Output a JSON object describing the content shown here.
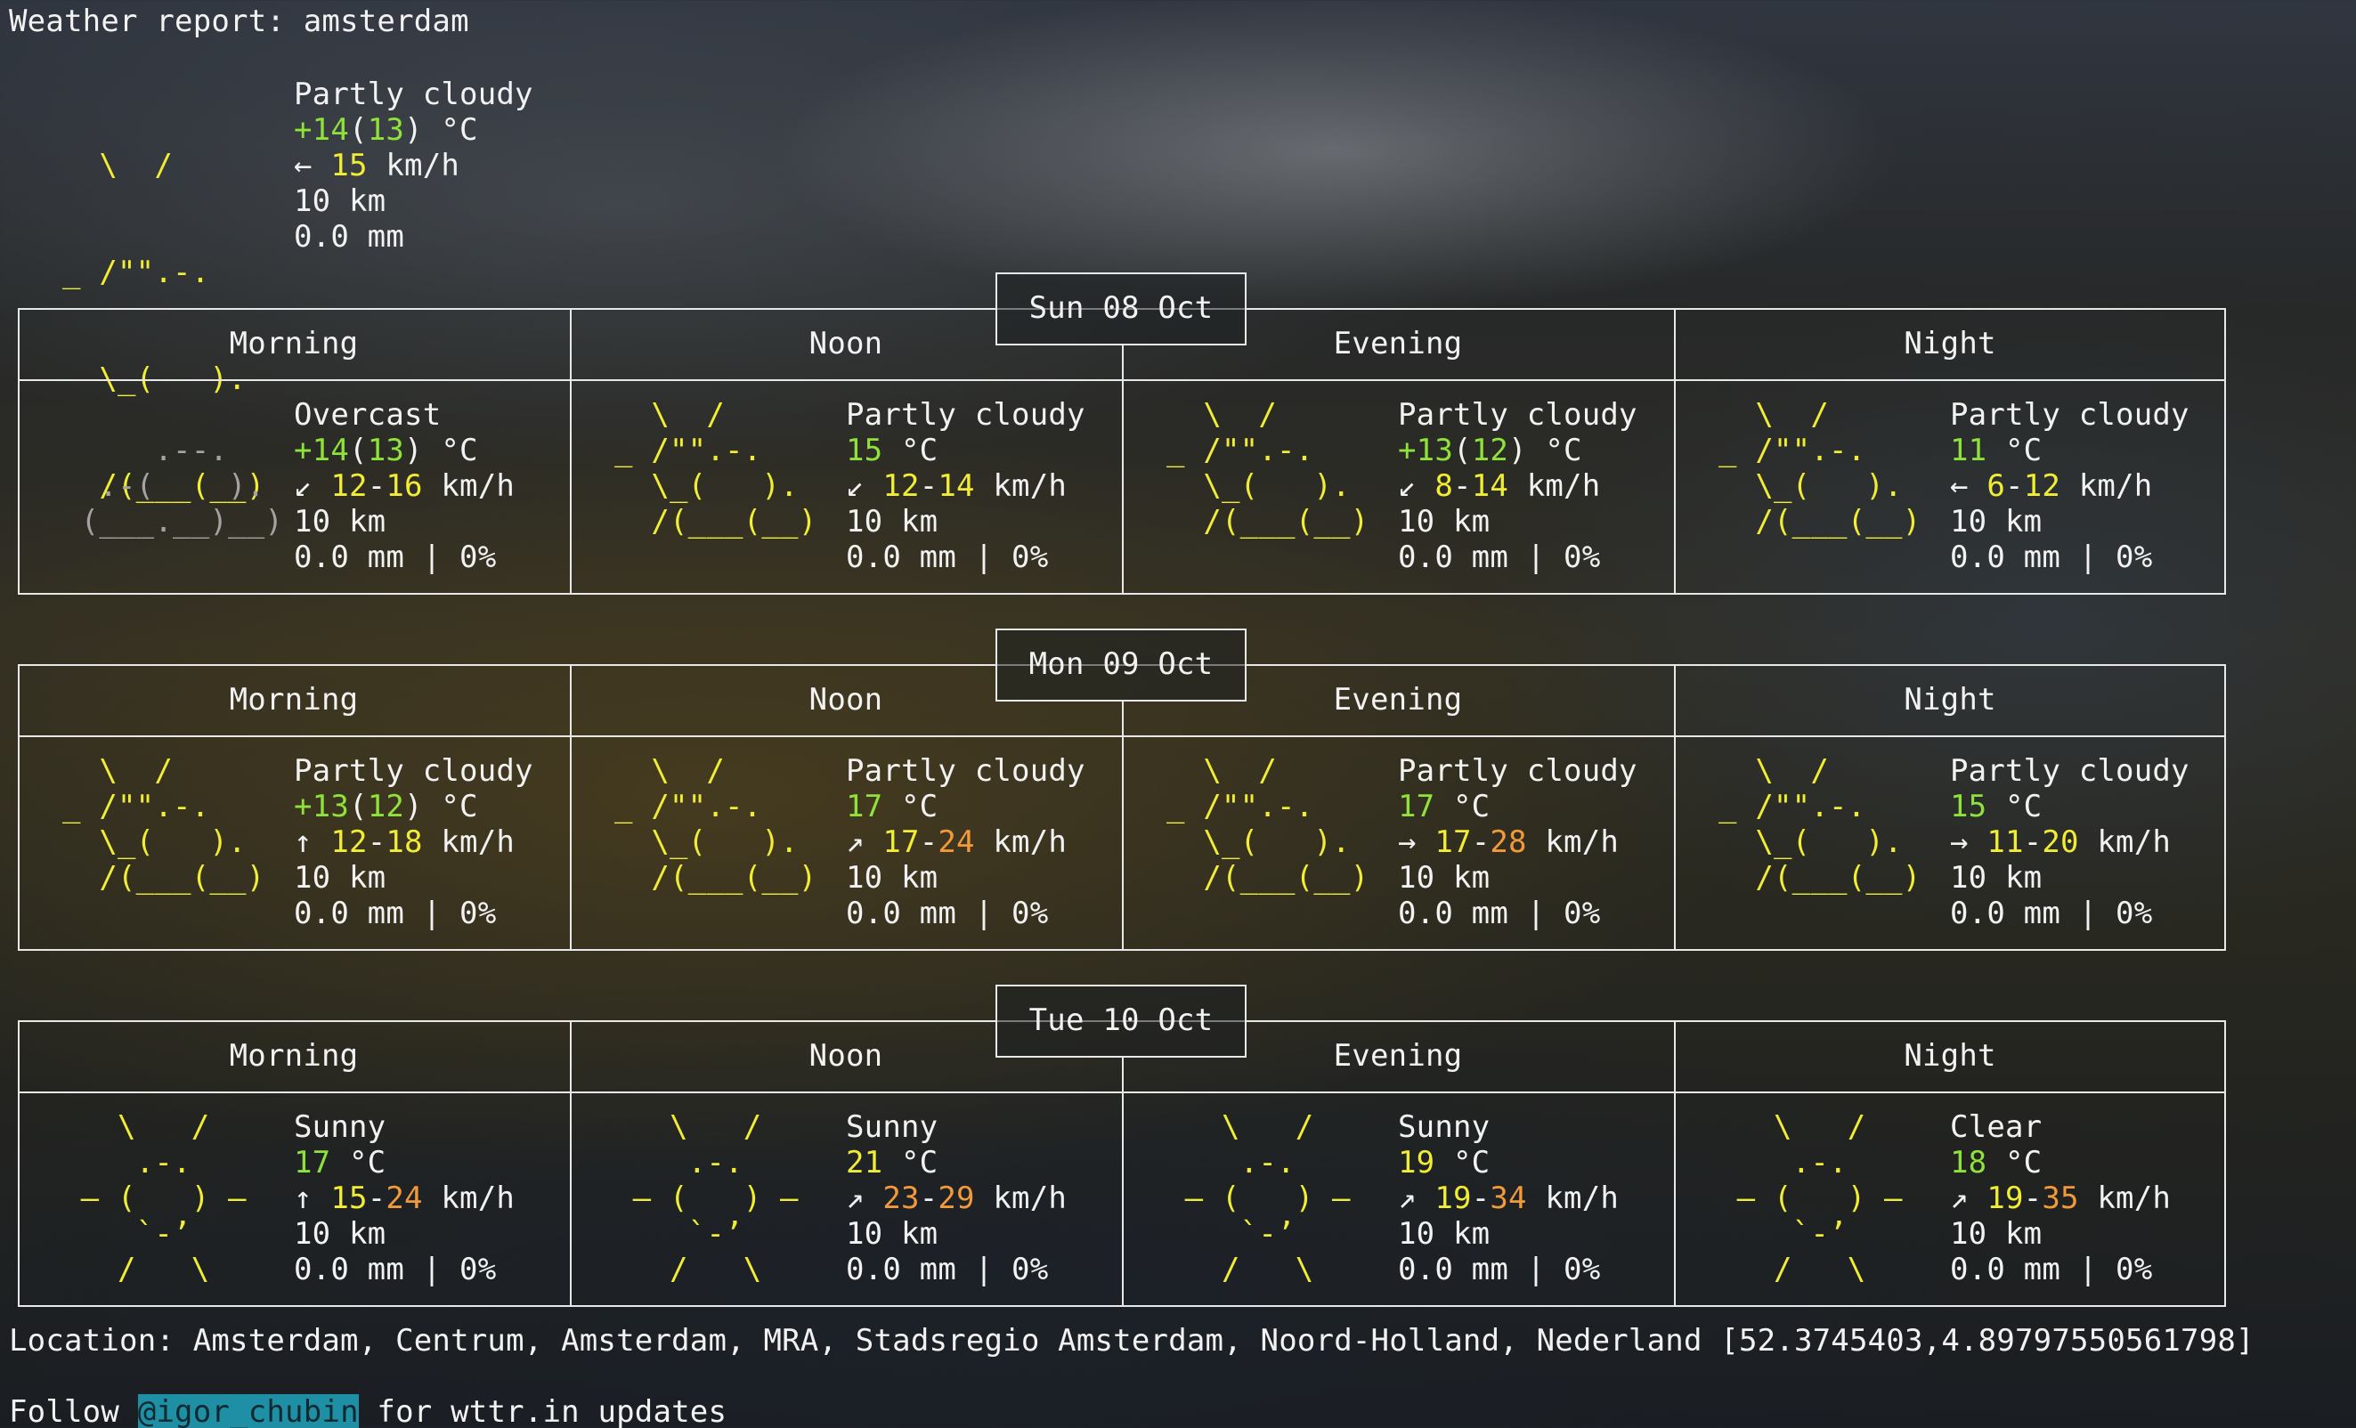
{
  "report": {
    "title": "Weather report: amsterdam"
  },
  "current": {
    "art": [
      "  \\  /",
      "_ /\"\".-.",
      "  \\_(   ).",
      "  /(___(__)"
    ],
    "condition": "Partly cloudy",
    "temp_main": "+14",
    "temp_paren_open": "(",
    "temp_feels": "13",
    "temp_paren_close": ")",
    "temp_unit": " °C",
    "wind_arrow": "←",
    "wind_value": "15",
    "wind_unit": " km/h",
    "visibility": "10 km",
    "precip": "0.0 mm"
  },
  "column_headers": [
    "Morning",
    "Noon",
    "Evening",
    "Night"
  ],
  "days": [
    {
      "date": "Sun 08 Oct",
      "slots": [
        {
          "art": [
            "",
            "     .--.",
            "  .-(    ).",
            " (___.__)__)"
          ],
          "art_color": "gray",
          "condition": "Overcast",
          "temp": [
            {
              "t": "+14",
              "c": "g"
            },
            {
              "t": "(",
              "c": ""
            },
            {
              "t": "13",
              "c": "g"
            },
            {
              "t": ")",
              "c": ""
            },
            {
              "t": " °C",
              "c": ""
            }
          ],
          "wind": [
            {
              "t": "↙ ",
              "c": ""
            },
            {
              "t": "12",
              "c": "y"
            },
            {
              "t": "-",
              "c": ""
            },
            {
              "t": "16",
              "c": "y"
            },
            {
              "t": " km/h",
              "c": ""
            }
          ],
          "visibility": "10 km",
          "precip": "0.0 mm | 0%"
        },
        {
          "art": [
            "  \\  /",
            "_ /\"\".-.",
            "  \\_(   ).",
            "  /(___(__)"
          ],
          "art_color": "y",
          "condition": "Partly cloudy",
          "temp": [
            {
              "t": "15",
              "c": "g"
            },
            {
              "t": " °C",
              "c": ""
            }
          ],
          "wind": [
            {
              "t": "↙ ",
              "c": ""
            },
            {
              "t": "12",
              "c": "y"
            },
            {
              "t": "-",
              "c": ""
            },
            {
              "t": "14",
              "c": "y"
            },
            {
              "t": " km/h",
              "c": ""
            }
          ],
          "visibility": "10 km",
          "precip": "0.0 mm | 0%"
        },
        {
          "art": [
            "  \\  /",
            "_ /\"\".-.",
            "  \\_(   ).",
            "  /(___(__)"
          ],
          "art_color": "y",
          "condition": "Partly cloudy",
          "temp": [
            {
              "t": "+13",
              "c": "g"
            },
            {
              "t": "(",
              "c": ""
            },
            {
              "t": "12",
              "c": "g"
            },
            {
              "t": ")",
              "c": ""
            },
            {
              "t": " °C",
              "c": ""
            }
          ],
          "wind": [
            {
              "t": "↙ ",
              "c": ""
            },
            {
              "t": "8",
              "c": "y"
            },
            {
              "t": "-",
              "c": ""
            },
            {
              "t": "14",
              "c": "y"
            },
            {
              "t": " km/h",
              "c": ""
            }
          ],
          "visibility": "10 km",
          "precip": "0.0 mm | 0%"
        },
        {
          "art": [
            "  \\  /",
            "_ /\"\".-.",
            "  \\_(   ).",
            "  /(___(__)"
          ],
          "art_color": "y",
          "condition": "Partly cloudy",
          "temp": [
            {
              "t": "11",
              "c": "g"
            },
            {
              "t": " °C",
              "c": ""
            }
          ],
          "wind": [
            {
              "t": "← ",
              "c": ""
            },
            {
              "t": "6",
              "c": "y"
            },
            {
              "t": "-",
              "c": ""
            },
            {
              "t": "12",
              "c": "y"
            },
            {
              "t": " km/h",
              "c": ""
            }
          ],
          "visibility": "10 km",
          "precip": "0.0 mm | 0%"
        }
      ]
    },
    {
      "date": "Mon 09 Oct",
      "slots": [
        {
          "art": [
            "  \\  /",
            "_ /\"\".-.",
            "  \\_(   ).",
            "  /(___(__)"
          ],
          "art_color": "y",
          "condition": "Partly cloudy",
          "temp": [
            {
              "t": "+13",
              "c": "g"
            },
            {
              "t": "(",
              "c": ""
            },
            {
              "t": "12",
              "c": "g"
            },
            {
              "t": ")",
              "c": ""
            },
            {
              "t": " °C",
              "c": ""
            }
          ],
          "wind": [
            {
              "t": "↑ ",
              "c": ""
            },
            {
              "t": "12",
              "c": "y"
            },
            {
              "t": "-",
              "c": ""
            },
            {
              "t": "18",
              "c": "y"
            },
            {
              "t": " km/h",
              "c": ""
            }
          ],
          "visibility": "10 km",
          "precip": "0.0 mm | 0%"
        },
        {
          "art": [
            "  \\  /",
            "_ /\"\".-.",
            "  \\_(   ).",
            "  /(___(__)"
          ],
          "art_color": "y",
          "condition": "Partly cloudy",
          "temp": [
            {
              "t": "17",
              "c": "g"
            },
            {
              "t": " °C",
              "c": ""
            }
          ],
          "wind": [
            {
              "t": "↗ ",
              "c": ""
            },
            {
              "t": "17",
              "c": "y"
            },
            {
              "t": "-",
              "c": ""
            },
            {
              "t": "24",
              "c": "o"
            },
            {
              "t": " km/h",
              "c": ""
            }
          ],
          "visibility": "10 km",
          "precip": "0.0 mm | 0%"
        },
        {
          "art": [
            "  \\  /",
            "_ /\"\".-.",
            "  \\_(   ).",
            "  /(___(__)"
          ],
          "art_color": "y",
          "condition": "Partly cloudy",
          "temp": [
            {
              "t": "17",
              "c": "g"
            },
            {
              "t": " °C",
              "c": ""
            }
          ],
          "wind": [
            {
              "t": "→ ",
              "c": ""
            },
            {
              "t": "17",
              "c": "y"
            },
            {
              "t": "-",
              "c": ""
            },
            {
              "t": "28",
              "c": "o"
            },
            {
              "t": " km/h",
              "c": ""
            }
          ],
          "visibility": "10 km",
          "precip": "0.0 mm | 0%"
        },
        {
          "art": [
            "  \\  /",
            "_ /\"\".-.",
            "  \\_(   ).",
            "  /(___(__)"
          ],
          "art_color": "y",
          "condition": "Partly cloudy",
          "temp": [
            {
              "t": "15",
              "c": "g"
            },
            {
              "t": " °C",
              "c": ""
            }
          ],
          "wind": [
            {
              "t": "→ ",
              "c": ""
            },
            {
              "t": "11",
              "c": "y"
            },
            {
              "t": "-",
              "c": ""
            },
            {
              "t": "20",
              "c": "y"
            },
            {
              "t": " km/h",
              "c": ""
            }
          ],
          "visibility": "10 km",
          "precip": "0.0 mm | 0%"
        }
      ]
    },
    {
      "date": "Tue 10 Oct",
      "slots": [
        {
          "art": [
            "   \\   /",
            "    .-.",
            " ― (   ) ―",
            "    `-’",
            "   /   \\"
          ],
          "art_color": "y",
          "condition": "Sunny",
          "temp": [
            {
              "t": "17",
              "c": "g"
            },
            {
              "t": " °C",
              "c": ""
            }
          ],
          "wind": [
            {
              "t": "↑ ",
              "c": ""
            },
            {
              "t": "15",
              "c": "y"
            },
            {
              "t": "-",
              "c": ""
            },
            {
              "t": "24",
              "c": "o"
            },
            {
              "t": " km/h",
              "c": ""
            }
          ],
          "visibility": "10 km",
          "precip": "0.0 mm | 0%"
        },
        {
          "art": [
            "   \\   /",
            "    .-.",
            " ― (   ) ―",
            "    `-’",
            "   /   \\"
          ],
          "art_color": "y",
          "condition": "Sunny",
          "temp": [
            {
              "t": "21",
              "c": "y"
            },
            {
              "t": " °C",
              "c": ""
            }
          ],
          "wind": [
            {
              "t": "↗ ",
              "c": ""
            },
            {
              "t": "23",
              "c": "o"
            },
            {
              "t": "-",
              "c": ""
            },
            {
              "t": "29",
              "c": "o"
            },
            {
              "t": " km/h",
              "c": ""
            }
          ],
          "visibility": "10 km",
          "precip": "0.0 mm | 0%"
        },
        {
          "art": [
            "   \\   /",
            "    .-.",
            " ― (   ) ―",
            "    `-’",
            "   /   \\"
          ],
          "art_color": "y",
          "condition": "Sunny",
          "temp": [
            {
              "t": "19",
              "c": "y"
            },
            {
              "t": " °C",
              "c": ""
            }
          ],
          "wind": [
            {
              "t": "↗ ",
              "c": ""
            },
            {
              "t": "19",
              "c": "y"
            },
            {
              "t": "-",
              "c": ""
            },
            {
              "t": "34",
              "c": "o"
            },
            {
              "t": " km/h",
              "c": ""
            }
          ],
          "visibility": "10 km",
          "precip": "0.0 mm | 0%"
        },
        {
          "art": [
            "   \\   /",
            "    .-.",
            " ― (   ) ―",
            "    `-’",
            "   /   \\"
          ],
          "art_color": "y",
          "condition": "Clear",
          "temp": [
            {
              "t": "18",
              "c": "g"
            },
            {
              "t": " °C",
              "c": ""
            }
          ],
          "wind": [
            {
              "t": "↗ ",
              "c": ""
            },
            {
              "t": "19",
              "c": "y"
            },
            {
              "t": "-",
              "c": ""
            },
            {
              "t": "35",
              "c": "o"
            },
            {
              "t": " km/h",
              "c": ""
            }
          ],
          "visibility": "10 km",
          "precip": "0.0 mm | 0%"
        }
      ]
    }
  ],
  "footer": {
    "location": "Location: Amsterdam, Centrum, Amsterdam, MRA, Stadsregio Amsterdam, Noord-Holland, Nederland [52.3745403,4.89797550561798]",
    "follow_prefix": "Follow ",
    "follow_handle": "@igor_chubin",
    "follow_suffix": " for wttr.in updates"
  },
  "colors": {
    "yellow": "#f1ec34",
    "green": "#8fe23a",
    "orange": "#f29a3a",
    "handle_bg": "#1f8fa5"
  }
}
